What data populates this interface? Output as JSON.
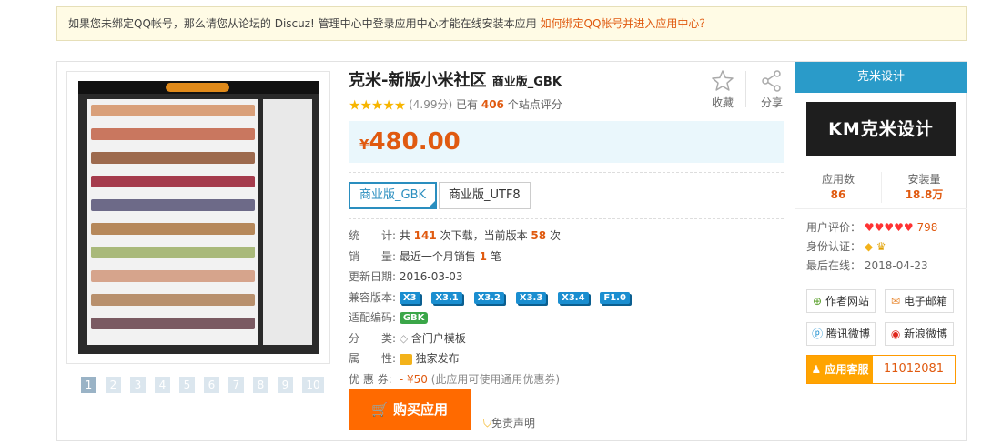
{
  "notice": {
    "text": "如果您未绑定QQ帐号，那么请您从论坛的 Discuz! 管理中心中登录应用中心才能在线安装本应用",
    "link": "如何绑定QQ帐号并进入应用中心？"
  },
  "gallery": {
    "pages": [
      "1",
      "2",
      "3",
      "4",
      "5",
      "6",
      "7",
      "8",
      "9",
      "10"
    ],
    "active_page": "1"
  },
  "product": {
    "name": "克米-新版小米社区",
    "edition": "商业版_GBK",
    "score": "(4.99分)",
    "rating_prefix": "已有",
    "rating_count": "406",
    "rating_suffix": "个站点评分",
    "rating_stars": 5,
    "favorite_label": "收藏",
    "share_label": "分享",
    "currency": "¥",
    "price": "480.00",
    "editions": [
      "商业版_GBK",
      "商业版_UTF8"
    ],
    "selected_edition": "商业版_GBK"
  },
  "details": {
    "stats_label": "统　　计:",
    "stats_prefix": "共",
    "downloads": "141",
    "stats_mid": "次下载，当前版本",
    "version_downloads": "58",
    "stats_suffix": "次",
    "sales_label": "销　　量:",
    "sales_prefix": "最近一个月销售",
    "sales_count": "1",
    "sales_suffix": "笔",
    "updated_label": "更新日期:",
    "updated": "2016-03-03",
    "compat_label": "兼容版本:",
    "compat": [
      "X3",
      "X3.1",
      "X3.2",
      "X3.3",
      "X3.4",
      "F1.0"
    ],
    "encoding_label": "适配编码:",
    "encoding": "GBK",
    "category_label": "分　　类:",
    "category": "含门户模板",
    "attribute_label": "属　　性:",
    "attribute": "独家发布",
    "coupon_label": "优 惠 券:",
    "coupon_value": "- ¥50",
    "coupon_note": "(此应用可使用通用优惠券)"
  },
  "buy": {
    "label": "购买应用",
    "disclaimer": "免责声明"
  },
  "developer": {
    "name": "克米设计",
    "logo_text": "KM克米设计",
    "apps_label": "应用数",
    "apps": "86",
    "installs_label": "安装量",
    "installs": "18.8万",
    "user_rating_label": "用户评价：",
    "user_rating_hearts": "♥♥♥♥♥",
    "user_rating": "798",
    "verify_label": "身份认证：",
    "last_online_label": "最后在线：",
    "last_online": "2018-04-23",
    "buttons": {
      "website": "作者网站",
      "email": "电子邮箱",
      "tencent_weibo": "腾讯微博",
      "sina_weibo": "新浪微博"
    },
    "service_label": "应用客服",
    "service_qq": "11012081"
  },
  "colors": {
    "accent": "#2a9bc9",
    "price": "#e05a10",
    "buy": "#ff6a00",
    "notice_bg": "#fffbe5"
  }
}
